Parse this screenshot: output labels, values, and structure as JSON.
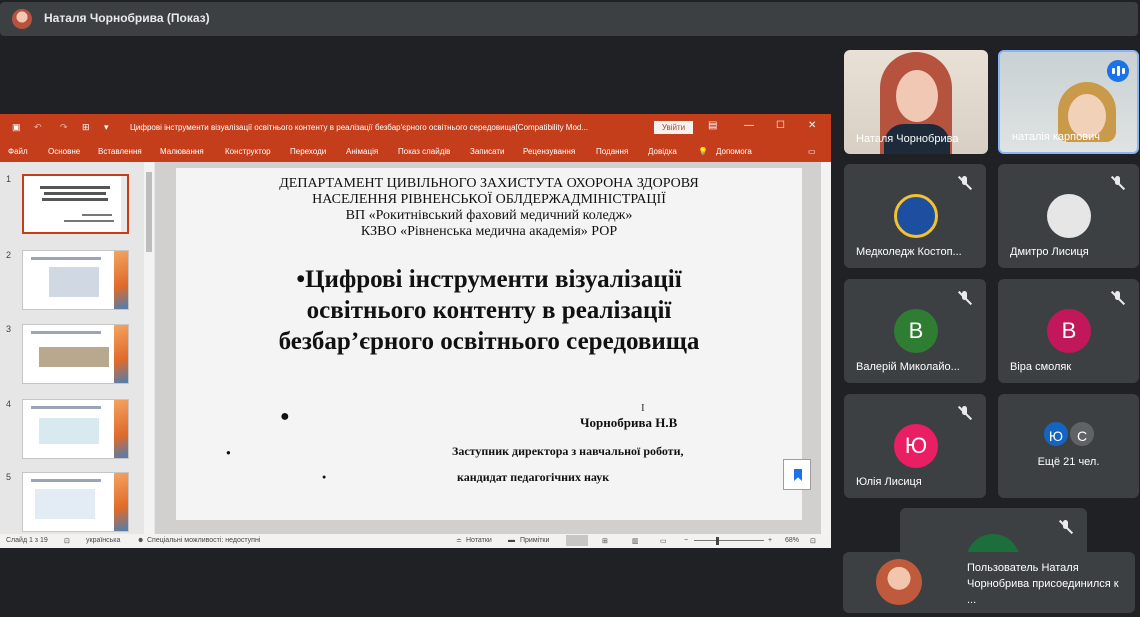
{
  "presenter_bar": {
    "title": "Наталя Чорнобрива (Показ)"
  },
  "ppt": {
    "window_title": "Цифрові інструменти візуалізації освітнього контенту в реалізації безбар'єрного освітнього середовища[Compatibility Mod...",
    "signin_label": "Увійти",
    "ribbon": [
      "Файл",
      "Основне",
      "Вставлення",
      "Малювання",
      "Конструктор",
      "Переходи",
      "Анімація",
      "Показ слайдів",
      "Записати",
      "Рецензування",
      "Подання",
      "Довідка",
      "Допомога"
    ],
    "thumb_numbers": [
      "1",
      "2",
      "3",
      "4",
      "5"
    ],
    "slide": {
      "header_lines": [
        "ДЕПАРТАМЕНТ ЦИВІЛЬНОГО ЗАХИСТУТА ОХОРОНА ЗДОРОВЯ",
        "НАСЕЛЕННЯ РІВНЕНСЬКОЇ ОБЛДЕРЖАДМІНІСТРАЦІЇ",
        "ВП «Рокитнівський фаховий медичний коледж»",
        "КЗВО «Рівненська медична академія» РОР"
      ],
      "title_lines": [
        "•Цифрові інструменти візуалізації",
        "освітнього контенту в реалізації",
        "безбар’єрного освітнього середовища"
      ],
      "author": "Чорнобрива Н.В",
      "position": "Заступник директора з навчальної роботи,",
      "degree": "кандидат педагогічних наук"
    },
    "status": {
      "slide_of": "Слайд 1 з 19",
      "language": "українська",
      "accessibility": "Спеціальні можливості: недоступні",
      "notes": "Нотатки",
      "comments": "Примітки",
      "zoom": "68%"
    }
  },
  "participants": [
    {
      "name": "Наталя Чорнобрива"
    },
    {
      "name": "наталія карпович"
    },
    {
      "name": "Медколедж Костоп..."
    },
    {
      "name": "Дмитро Лисиця"
    },
    {
      "name": "Валерій Миколайо...",
      "initial": "В",
      "color": "#2e7d32"
    },
    {
      "name": "Віра смоляк",
      "initial": "В",
      "color": "#c2185b"
    },
    {
      "name": "Юлія Лисиця",
      "initial": "Ю",
      "color": "#e91e63"
    }
  ],
  "more": {
    "label": "Ещё 21 чел.",
    "av1": "Ю",
    "av2": "С"
  },
  "toast": {
    "message": "Пользователь Наталя Чорнобрива присоединился к ..."
  }
}
